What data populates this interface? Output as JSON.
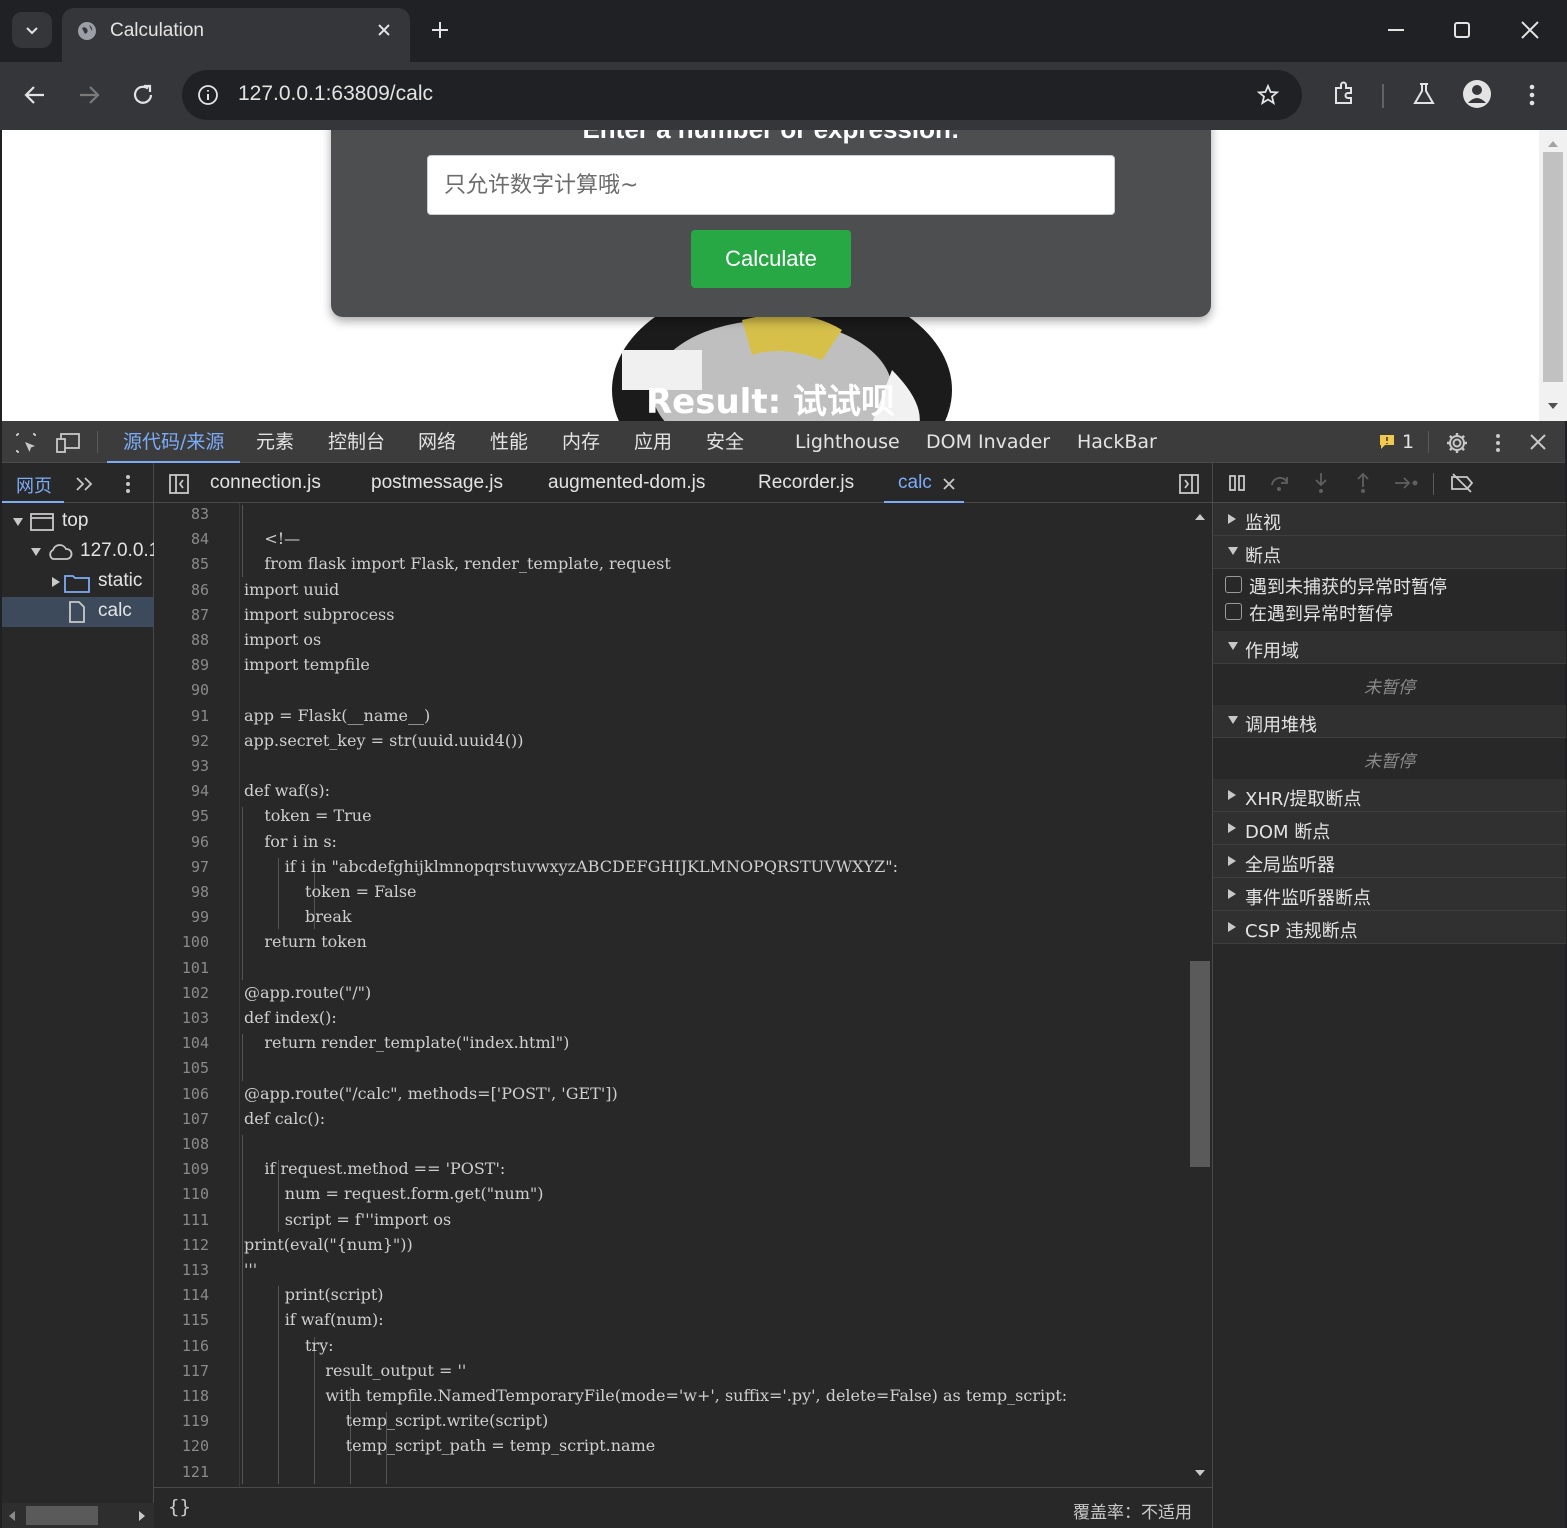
{
  "browser": {
    "tab_title": "Calculation",
    "url": "127.0.0.1:63809/calc"
  },
  "page": {
    "heading": "Enter a number or expression:",
    "input_placeholder": "只允许数字计算哦~",
    "button_label": "Calculate",
    "result": "Result: 试试呗"
  },
  "devtools": {
    "tabs": [
      "源代码/来源",
      "元素",
      "控制台",
      "网络",
      "性能",
      "内存",
      "应用",
      "安全",
      "Lighthouse",
      "DOM Invader",
      "HackBar"
    ],
    "issues_count": "1",
    "navigator": {
      "tab_label": "网页",
      "tree": [
        "top",
        "127.0.0.1",
        "static",
        "calc"
      ]
    },
    "file_tabs": [
      "connection.js",
      "postmessage.js",
      "augmented-dom.js",
      "Recorder.js",
      "calc"
    ],
    "code": [
      {
        "n": "83",
        "t": ""
      },
      {
        "n": "84",
        "t": "    <!—"
      },
      {
        "n": "85",
        "t": "    from flask import Flask, render_template, request"
      },
      {
        "n": "86",
        "t": "import uuid"
      },
      {
        "n": "87",
        "t": "import subprocess"
      },
      {
        "n": "88",
        "t": "import os"
      },
      {
        "n": "89",
        "t": "import tempfile"
      },
      {
        "n": "90",
        "t": ""
      },
      {
        "n": "91",
        "t": "app = Flask(__name__)"
      },
      {
        "n": "92",
        "t": "app.secret_key = str(uuid.uuid4())"
      },
      {
        "n": "93",
        "t": ""
      },
      {
        "n": "94",
        "t": "def waf(s):"
      },
      {
        "n": "95",
        "t": "    token = True"
      },
      {
        "n": "96",
        "t": "    for i in s:"
      },
      {
        "n": "97",
        "t": "        if i in \"abcdefghijklmnopqrstuvwxyzABCDEFGHIJKLMNOPQRSTUVWXYZ\":"
      },
      {
        "n": "98",
        "t": "            token = False"
      },
      {
        "n": "99",
        "t": "            break"
      },
      {
        "n": "100",
        "t": "    return token"
      },
      {
        "n": "101",
        "t": ""
      },
      {
        "n": "102",
        "t": "@app.route(\"/\")"
      },
      {
        "n": "103",
        "t": "def index():"
      },
      {
        "n": "104",
        "t": "    return render_template(\"index.html\")"
      },
      {
        "n": "105",
        "t": ""
      },
      {
        "n": "106",
        "t": "@app.route(\"/calc\", methods=['POST', 'GET'])"
      },
      {
        "n": "107",
        "t": "def calc():"
      },
      {
        "n": "108",
        "t": ""
      },
      {
        "n": "109",
        "t": "    if request.method == 'POST':"
      },
      {
        "n": "110",
        "t": "        num = request.form.get(\"num\")"
      },
      {
        "n": "111",
        "t": "        script = f'''import os"
      },
      {
        "n": "112",
        "t": "print(eval(\"{num}\"))"
      },
      {
        "n": "113",
        "t": "'''"
      },
      {
        "n": "114",
        "t": "        print(script)"
      },
      {
        "n": "115",
        "t": "        if waf(num):"
      },
      {
        "n": "116",
        "t": "            try:"
      },
      {
        "n": "117",
        "t": "                result_output = ''"
      },
      {
        "n": "118",
        "t": "                with tempfile.NamedTemporaryFile(mode='w+', suffix='.py', delete=False) as temp_script:"
      },
      {
        "n": "119",
        "t": "                    temp_script.write(script)"
      },
      {
        "n": "120",
        "t": "                    temp_script_path = temp_script.name"
      },
      {
        "n": "121",
        "t": ""
      }
    ],
    "coverage": "覆盖率：不适用",
    "debugger": {
      "watch": "监视",
      "breakpoints": "断点",
      "pause_uncaught": "遇到未捕获的异常时暂停",
      "pause_caught": "在遇到异常时暂停",
      "scope": "作用域",
      "not_paused_1": "未暂停",
      "call_stack": "调用堆栈",
      "not_paused_2": "未暂停",
      "xhr": "XHR/提取断点",
      "dom": "DOM 断点",
      "global": "全局监听器",
      "event": "事件监听器断点",
      "csp": "CSP 违规断点"
    }
  },
  "colors": {
    "accent": "#7cacf8",
    "button_green": "#28a745",
    "chrome_dark": "#202124",
    "devtools_bg": "#282828"
  }
}
